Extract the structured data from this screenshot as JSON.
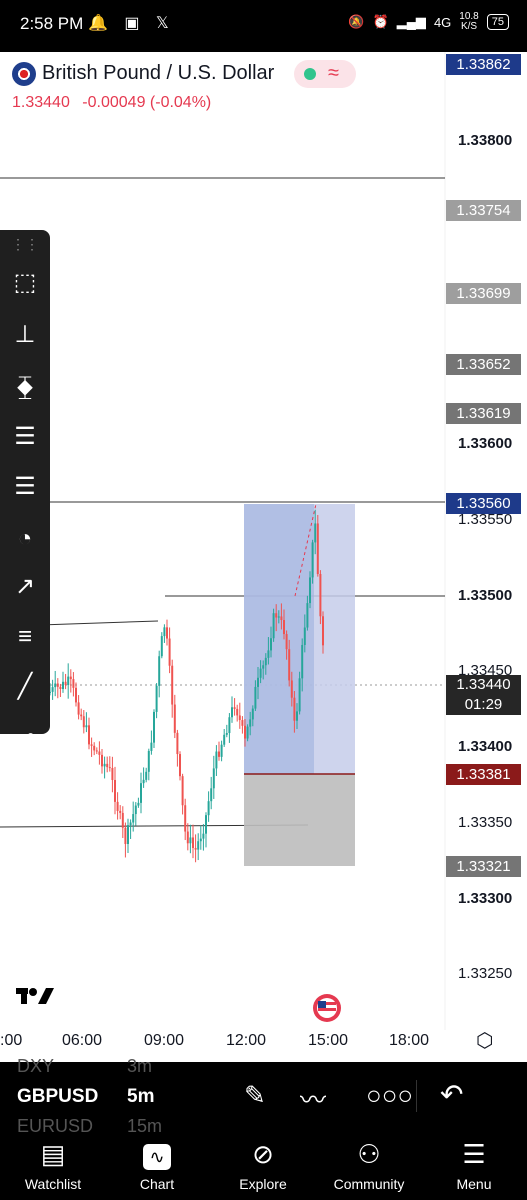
{
  "status_bar": {
    "time": "2:58 PM",
    "network_label": "4G",
    "speed": "10.8",
    "speed_unit": "K/S",
    "battery": "75"
  },
  "symbol": {
    "title": "British Pound / U.S. Dollar",
    "price": "1.33440",
    "change": "-0.00049 (-0.04%)"
  },
  "price_axis": {
    "labels": [
      "1.33800",
      "1.33600",
      "1.33550",
      "1.33500",
      "1.33450",
      "1.33400",
      "1.33350",
      "1.33300",
      "1.33250"
    ],
    "tags": {
      "top": "1.33862",
      "t1": "1.33754",
      "t2": "1.33699",
      "t3": "1.33652",
      "t4": "1.33619",
      "t5": "1.33560",
      "current": "1.33440",
      "countdown": "01:29",
      "stop": "1.33381",
      "target": "1.33321"
    }
  },
  "x_axis": {
    "labels": [
      ":00",
      "06:00",
      "09:00",
      "12:00",
      "15:00",
      "18:00"
    ]
  },
  "colors": {
    "up": "#26a69a",
    "down": "#ef5350",
    "tag_blue": "#1e3a8a",
    "tag_gray": "#9e9e9e",
    "tag_red": "#8b1a1a",
    "profit_zone": "#b9c3e4",
    "loss_zone": "#bdbdbd"
  },
  "watchlist_panel": {
    "rows": [
      {
        "symbol": "DXY",
        "interval": "3m"
      },
      {
        "symbol": "GBPUSD",
        "interval": "5m"
      },
      {
        "symbol": "EURUSD",
        "interval": "15m"
      }
    ]
  },
  "bottom_toolbar": {
    "icons": [
      "pen-icon",
      "drawing-tools-icon",
      "more-icon",
      "undo-icon"
    ]
  },
  "nav": {
    "items": [
      {
        "label": "Watchlist",
        "icon": "watchlist-icon"
      },
      {
        "label": "Chart",
        "icon": "chart-icon"
      },
      {
        "label": "Explore",
        "icon": "compass-icon"
      },
      {
        "label": "Community",
        "icon": "community-icon"
      },
      {
        "label": "Menu",
        "icon": "hamburger-icon"
      }
    ]
  }
}
